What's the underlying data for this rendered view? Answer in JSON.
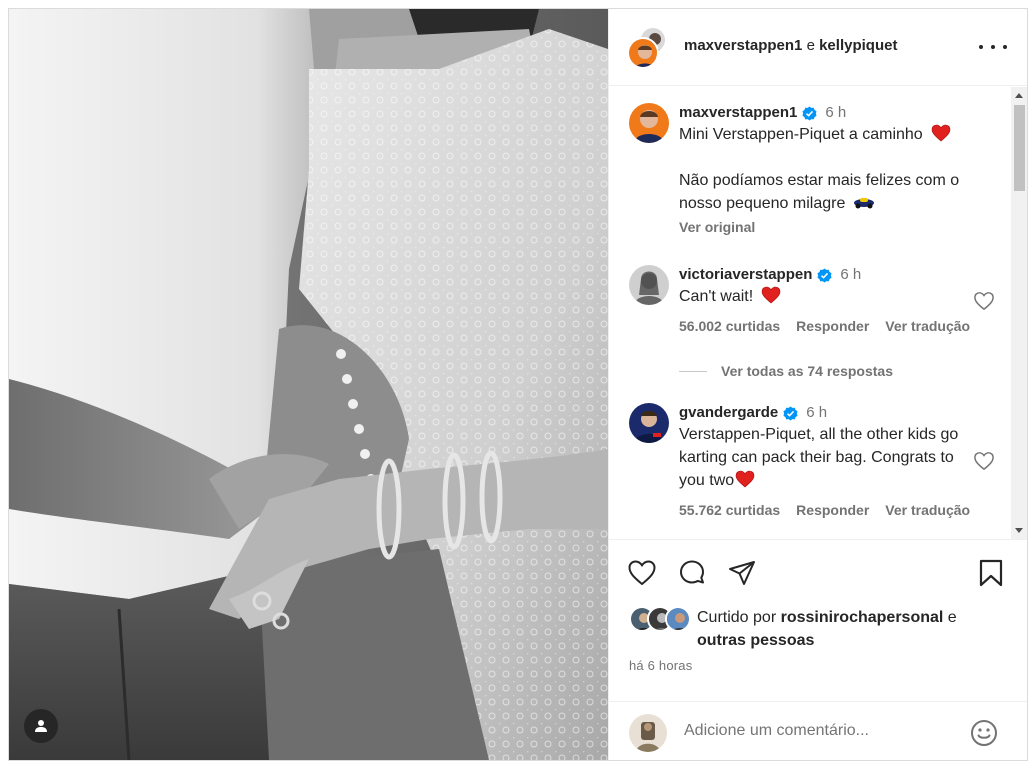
{
  "header": {
    "user1": "maxverstappen1",
    "conjunction": "e",
    "user2": "kellypiquet"
  },
  "caption": {
    "username": "maxverstappen1",
    "time": "6 h",
    "line1": "Mini Verstappen-Piquet a caminho",
    "line2": "Não podíamos estar mais felizes com o nosso pequeno milagre",
    "see_original": "Ver original"
  },
  "comments": [
    {
      "username": "victoriaverstappen",
      "time": "6 h",
      "text": "Can't wait!",
      "likes": "56.002 curtidas",
      "reply": "Responder",
      "translate": "Ver tradução"
    },
    {
      "username": "gvandergarde",
      "time": "6 h",
      "text": "Verstappen-Piquet, all the other kids go karting can pack their bag. Congrats to you two",
      "likes": "55.762 curtidas",
      "reply": "Responder",
      "translate": "Ver tradução"
    }
  ],
  "view_replies": "Ver todas as 74 respostas",
  "liked_by": {
    "prefix": "Curtido por",
    "user": "rossinirochapersonal",
    "conjunction": "e",
    "others": "outras pessoas"
  },
  "time_ago": "há 6 horas",
  "add_comment": {
    "placeholder": "Adicione um comentário..."
  },
  "colors": {
    "heart_red": "#e0211d",
    "verified_blue": "#0095f6",
    "secondary_text": "#737373"
  },
  "icons": [
    "more-options-icon",
    "verified-badge-icon",
    "heart-emoji-icon",
    "like-heart-icon",
    "comment-icon",
    "share-icon",
    "save-bookmark-icon",
    "emoji-icon",
    "user-tag-icon"
  ]
}
